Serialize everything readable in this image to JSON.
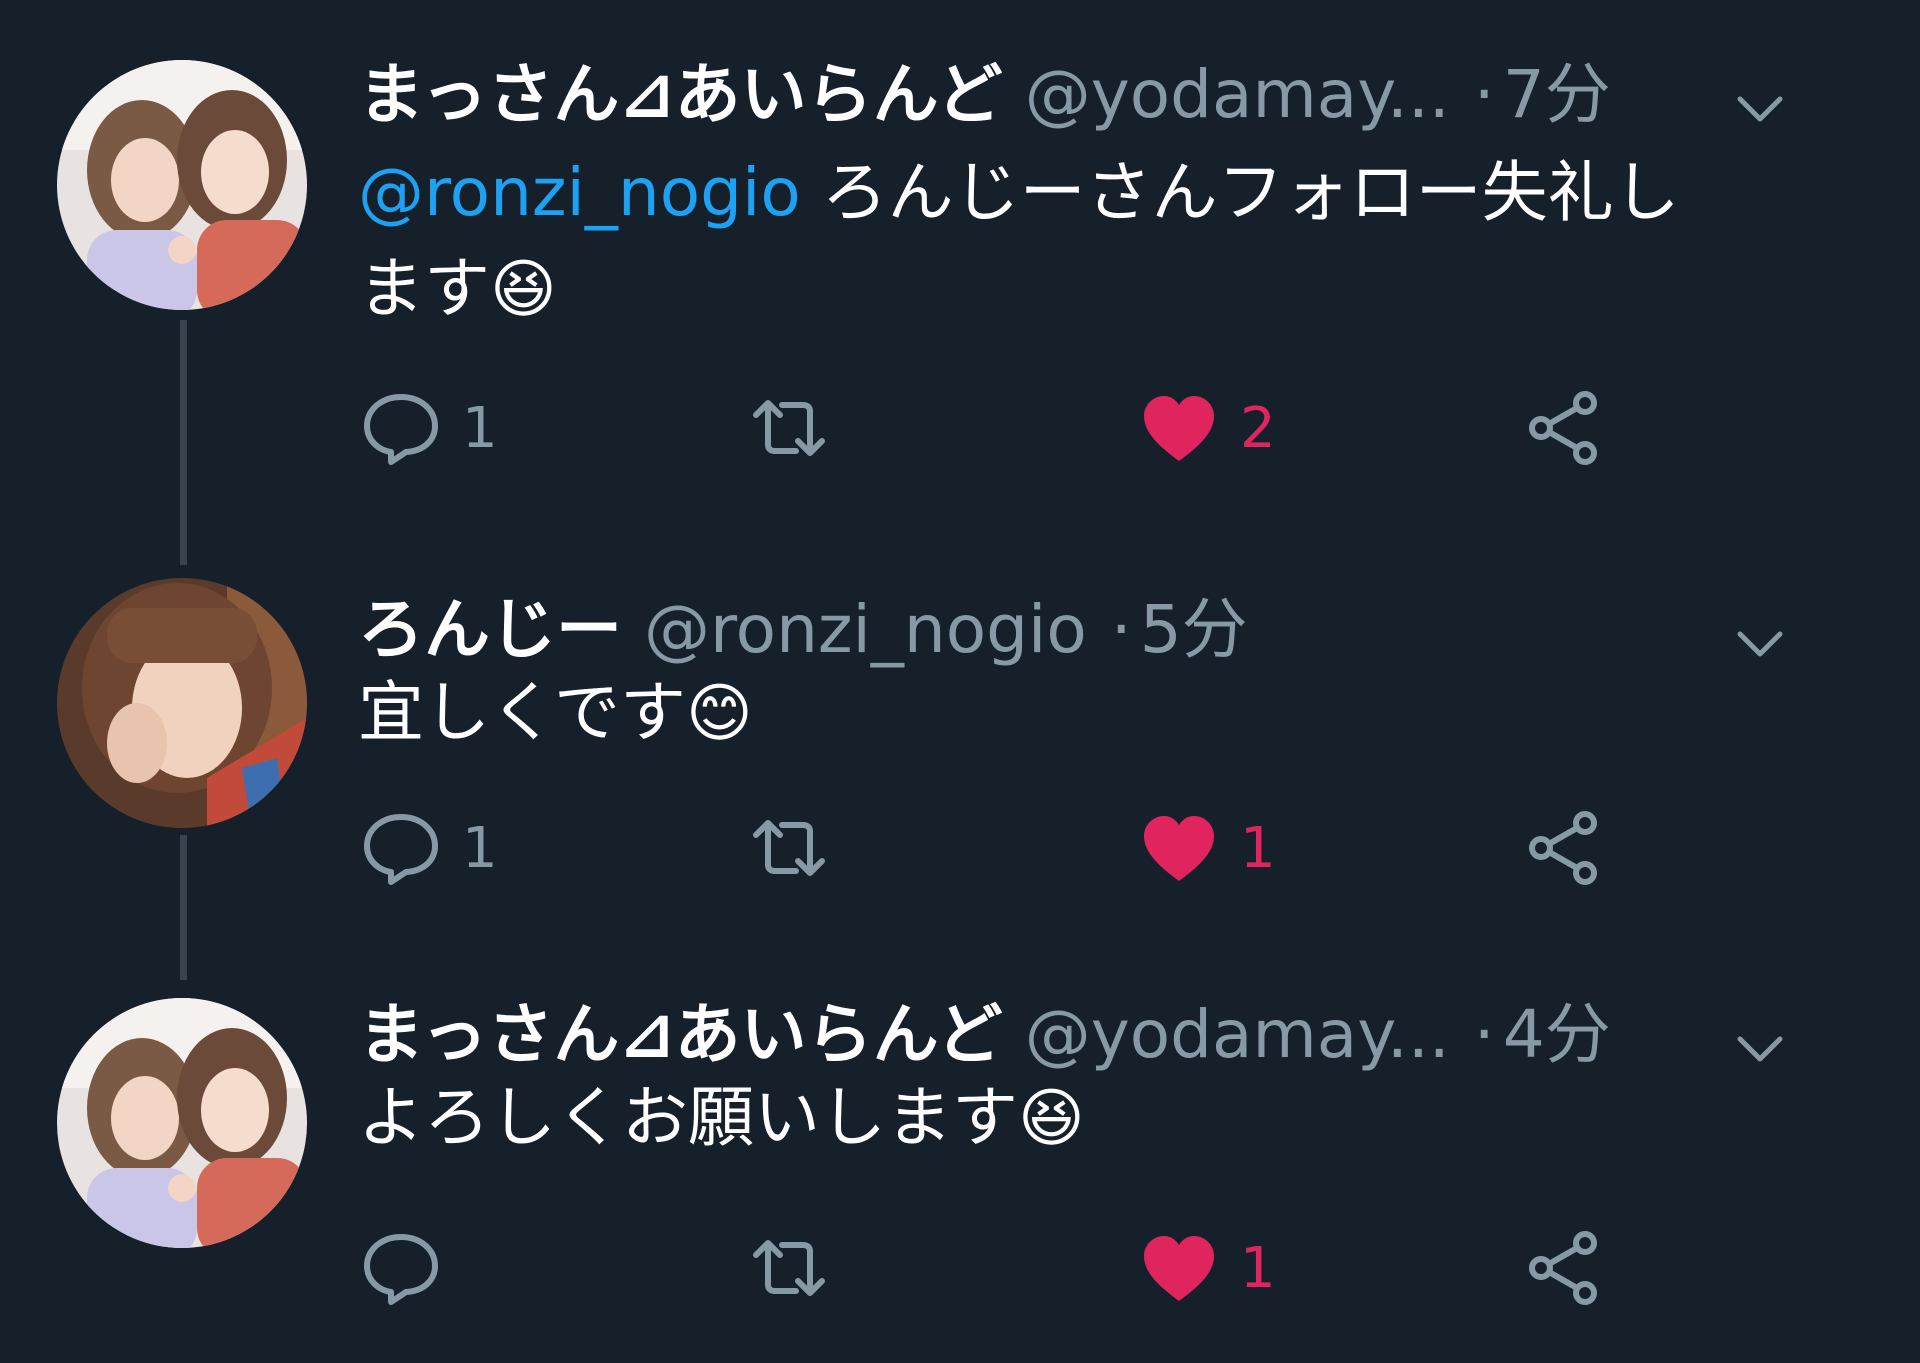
{
  "theme": {
    "background": "#15202b",
    "secondary_text": "#8899a6",
    "mention": "#1da1f2",
    "like": "#e0245e",
    "thread_line": "#38444d"
  },
  "tweets": [
    {
      "name": "まっさん⊿あいらんど",
      "handle": "@yodamay...",
      "time_sep": "·",
      "time": "7分",
      "mention": "@ronzi_nogio",
      "text_line1": " ろんじーさんフォロー失礼し",
      "text_line2": "ます",
      "emoji": "😆",
      "reply_count": "1",
      "retweet_count": "",
      "like_count": "2",
      "liked": true
    },
    {
      "name": "ろんじー",
      "handle": "@ronzi_nogio",
      "time_sep": "·",
      "time": "5分",
      "text": "宜しくです",
      "emoji": "😊",
      "reply_count": "1",
      "retweet_count": "",
      "like_count": "1",
      "liked": true
    },
    {
      "name": "まっさん⊿あいらんど",
      "handle": "@yodamay...",
      "time_sep": "·",
      "time": "4分",
      "text": "よろしくお願いします",
      "emoji": "😆",
      "reply_count": "",
      "retweet_count": "",
      "like_count": "1",
      "liked": true
    }
  ],
  "icons": {
    "reply": "reply-icon",
    "retweet": "retweet-icon",
    "like": "heart-icon",
    "share": "share-icon",
    "more": "chevron-down-icon"
  }
}
